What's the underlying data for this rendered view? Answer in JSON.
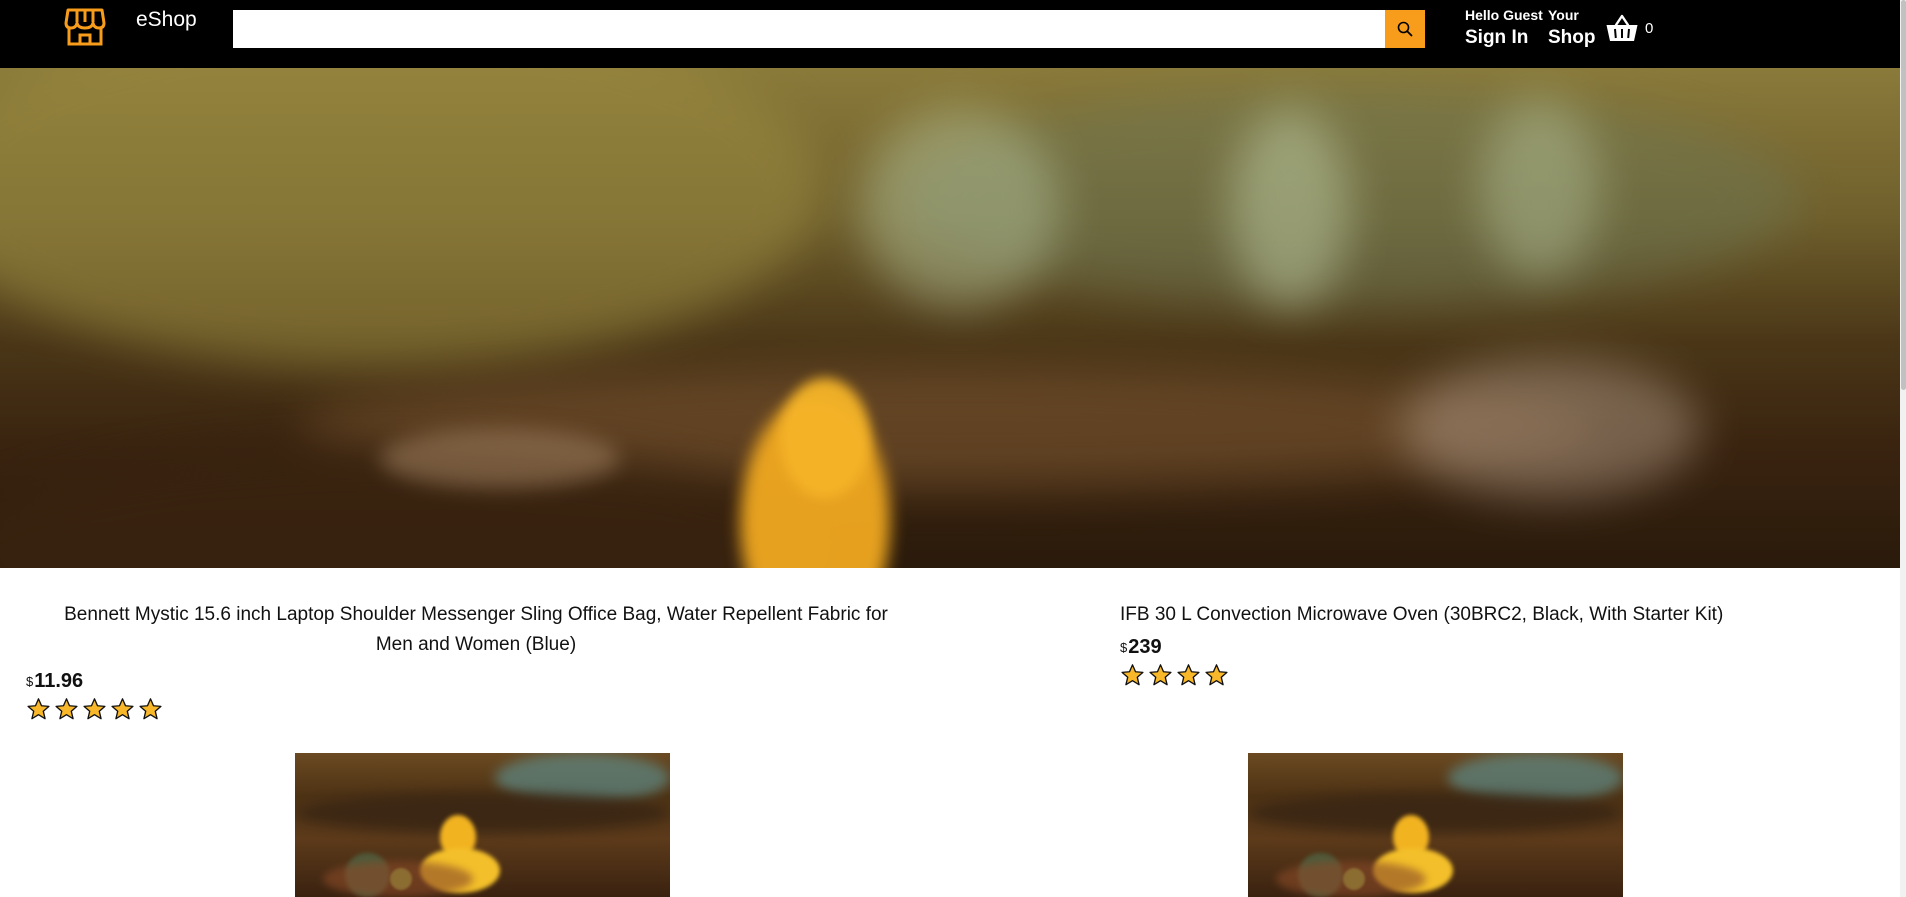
{
  "header": {
    "brand": "eShop",
    "search": {
      "placeholder": "",
      "value": ""
    },
    "greeting": "Hello Guest",
    "sign_in": "Sign In",
    "your": "Your",
    "shop": "Shop",
    "cart_count": "0",
    "accent": "#f89d1b"
  },
  "products": [
    {
      "title": "Bennett Mystic 15.6 inch Laptop Shoulder Messenger Sling Office Bag, Water Repellent Fabric for Men and Women (Blue)",
      "currency": "$",
      "price": "11.96",
      "rating": 5
    },
    {
      "title": "IFB 30 L Convection Microwave Oven (30BRC2, Black, With Starter Kit)",
      "currency": "$",
      "price": "239",
      "rating": 4
    }
  ],
  "icons": {
    "logo": "store-icon",
    "search": "search-icon",
    "cart": "basket-icon",
    "star": "star-icon"
  }
}
